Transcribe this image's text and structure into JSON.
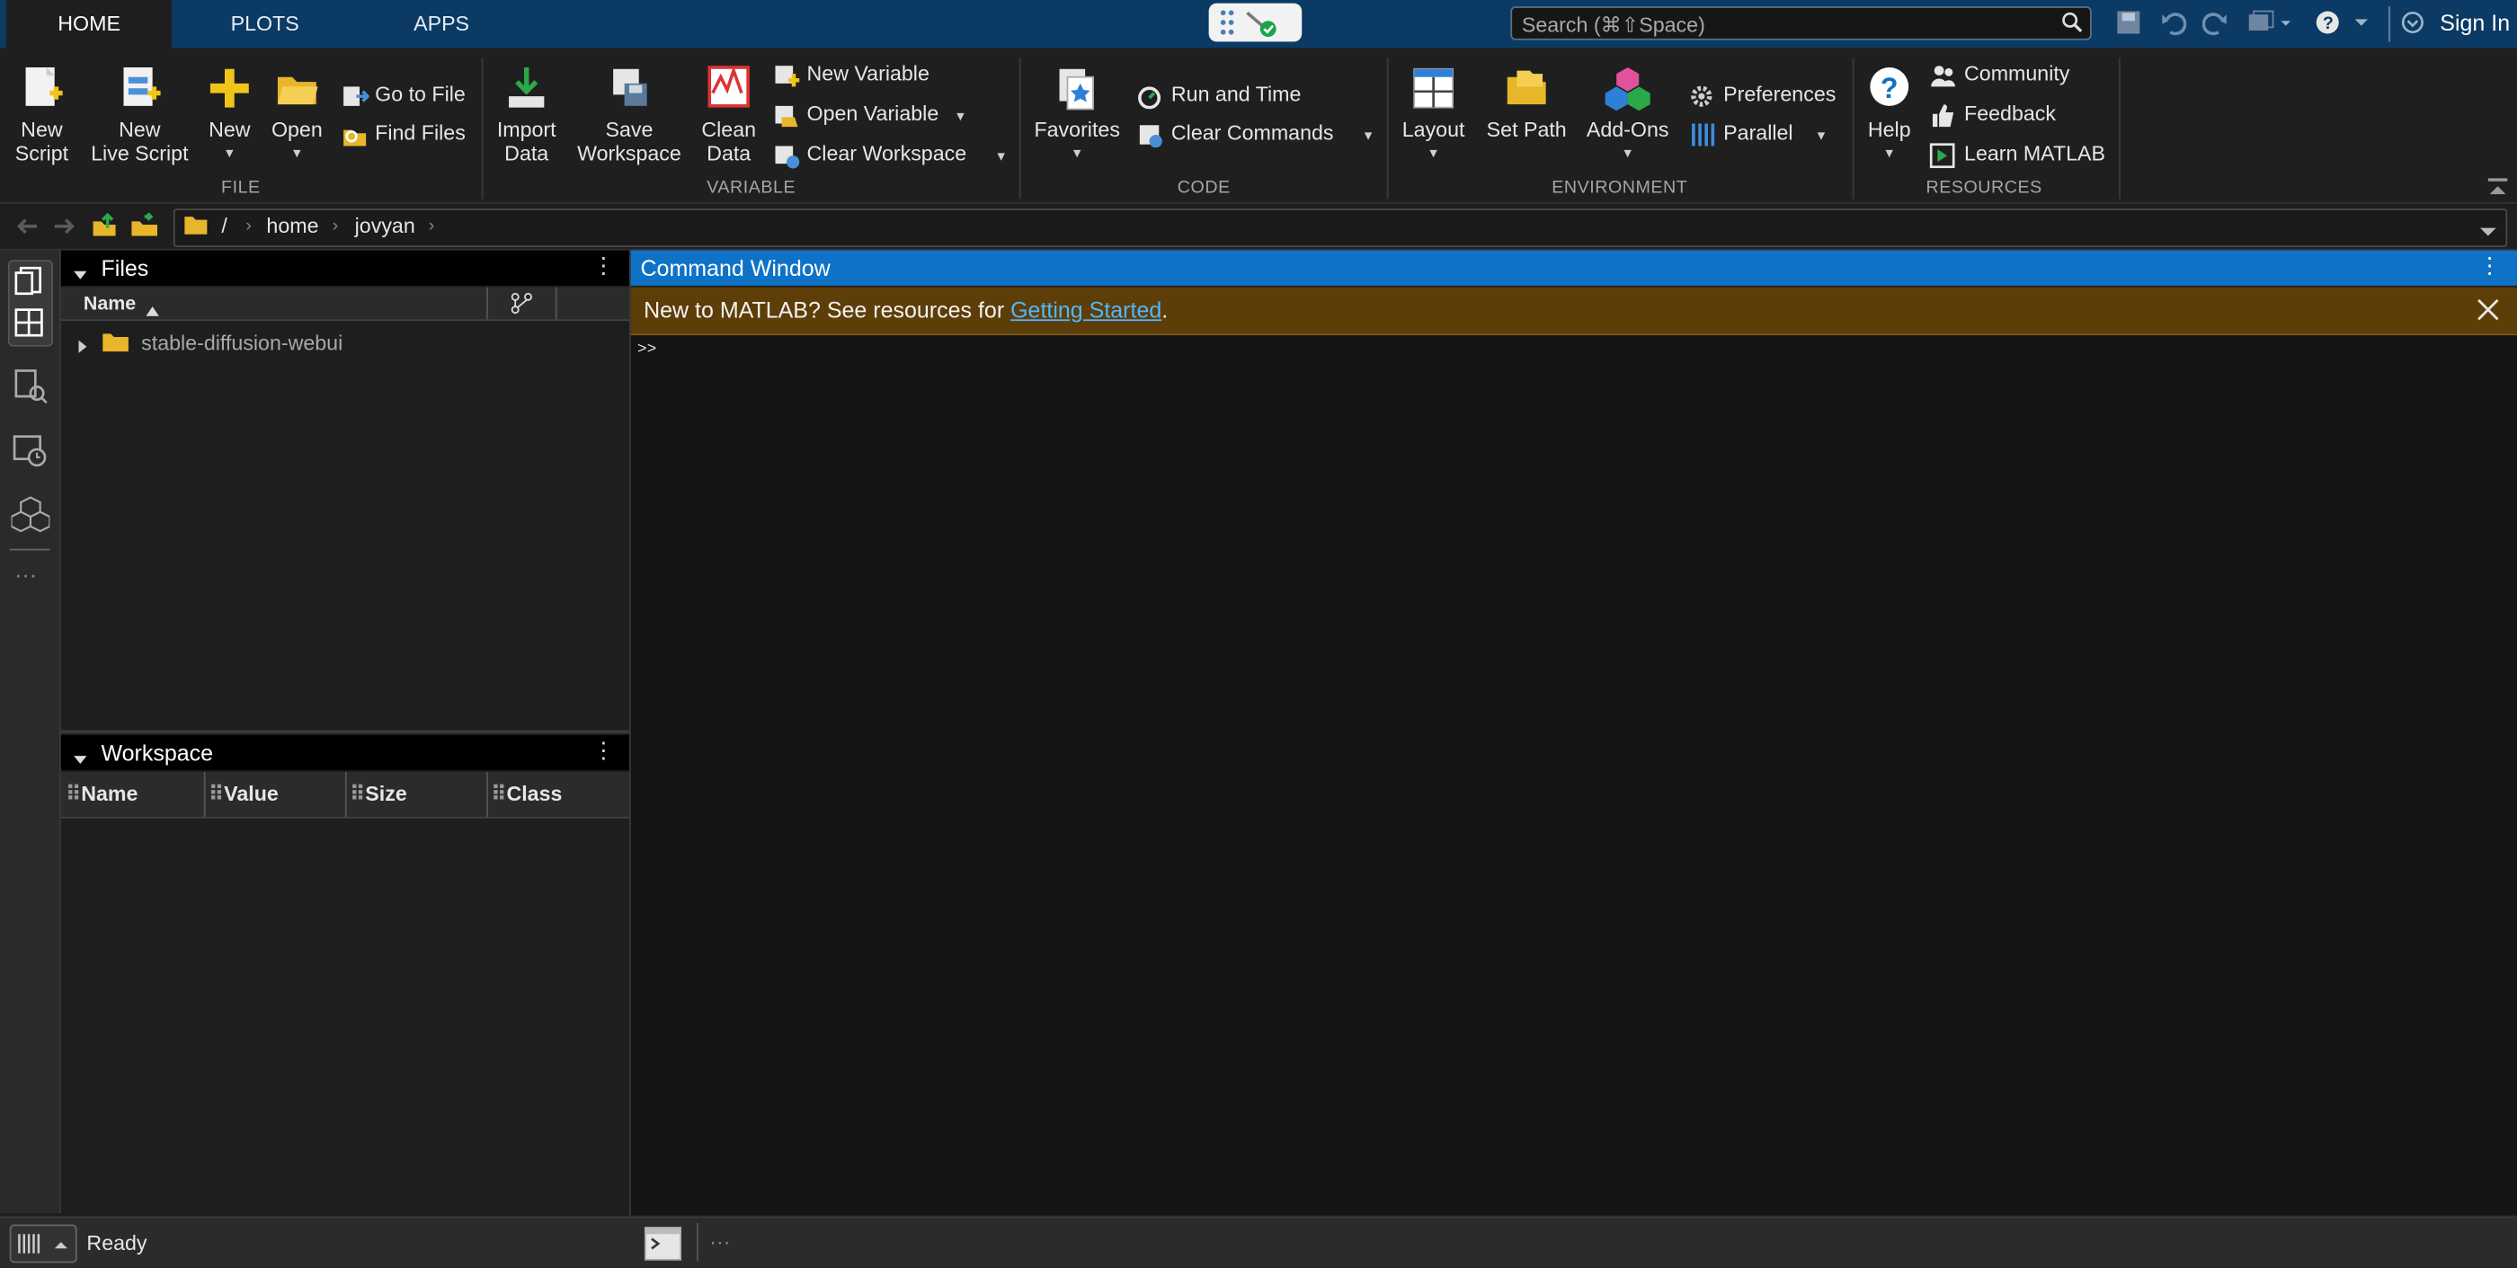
{
  "tabs": [
    "HOME",
    "PLOTS",
    "APPS"
  ],
  "search": {
    "placeholder": "Search (⌘⇧Space)"
  },
  "signin": "Sign In",
  "ribbon": {
    "file": {
      "new_script": [
        "New",
        "Script"
      ],
      "new_live_script": [
        "New",
        "Live Script"
      ],
      "new": "New",
      "open": "Open",
      "go_to_file": "Go to File",
      "find_files": "Find Files",
      "label": "FILE"
    },
    "variable": {
      "import_data": [
        "Import",
        "Data"
      ],
      "save_workspace": [
        "Save",
        "Workspace"
      ],
      "clean_data": [
        "Clean",
        "Data"
      ],
      "new_variable": "New Variable",
      "open_variable": "Open Variable",
      "clear_workspace": "Clear Workspace",
      "label": "VARIABLE"
    },
    "code": {
      "favorites": "Favorites",
      "run_and_time": "Run and Time",
      "clear_commands": "Clear Commands",
      "label": "CODE"
    },
    "environment": {
      "layout": "Layout",
      "set_path": "Set Path",
      "add_ons": "Add-Ons",
      "preferences": "Preferences",
      "parallel": "Parallel",
      "label": "ENVIRONMENT"
    },
    "resources": {
      "help": "Help",
      "community": "Community",
      "feedback": "Feedback",
      "learn_matlab": "Learn MATLAB",
      "label": "RESOURCES"
    }
  },
  "address": {
    "root": "/",
    "parts": [
      "home",
      "jovyan"
    ]
  },
  "files": {
    "title": "Files",
    "column": "Name",
    "items": [
      "stable-diffusion-webui"
    ]
  },
  "workspace": {
    "title": "Workspace",
    "columns": [
      "Name",
      "Value",
      "Size",
      "Class"
    ]
  },
  "command_window": {
    "title": "Command Window",
    "banner_text": "New to MATLAB? See resources for ",
    "banner_link": "Getting Started",
    "banner_end": ".",
    "prompt": ">>"
  },
  "status": "Ready",
  "colors": {
    "accent": "#0e72c6",
    "banner": "#5d3d08",
    "topbar": "#0b3a64"
  }
}
